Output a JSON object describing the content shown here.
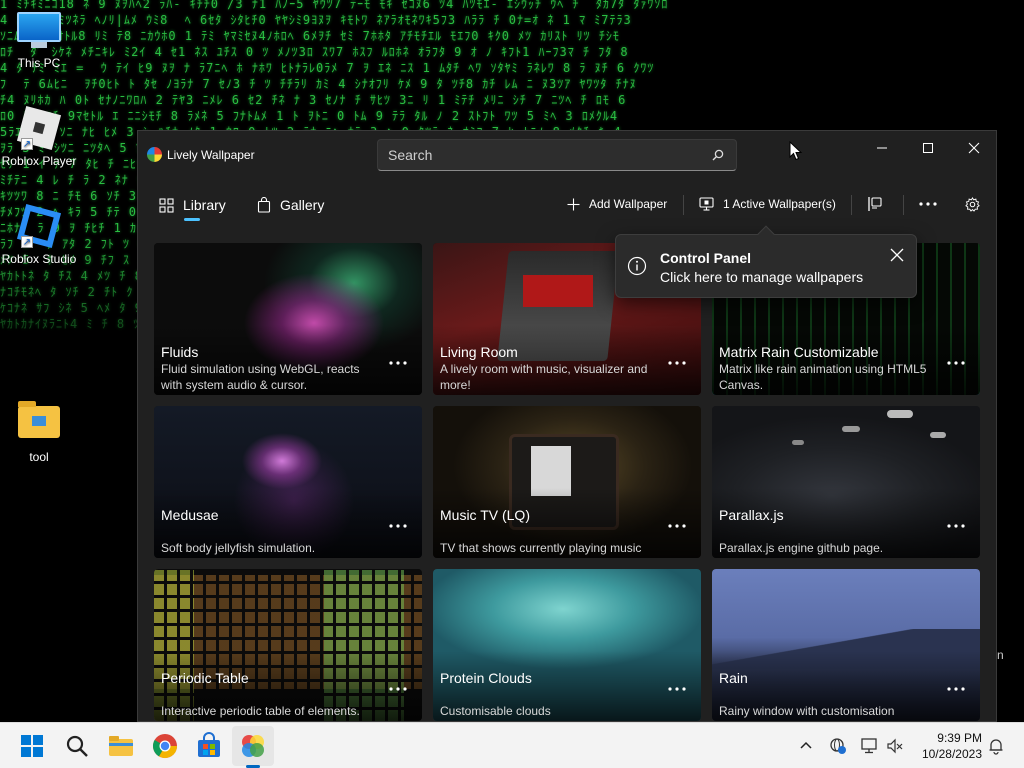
{
  "desktop": {
    "icons": [
      {
        "label": "This PC"
      },
      {
        "label": "Roblox Player"
      },
      {
        "label": "Roblox Studio"
      },
      {
        "label": "tool"
      }
    ],
    "edge_text": "n"
  },
  "window": {
    "title": "Lively Wallpaper",
    "search_placeholder": "Search",
    "nav": {
      "library": "Library",
      "gallery": "Gallery",
      "add_wallpaper": "Add Wallpaper",
      "active_wallpapers": "1 Active Wallpaper(s)"
    },
    "tooltip": {
      "title": "Control Panel",
      "text": "Click here to manage wallpapers"
    },
    "wallpapers": [
      {
        "title": "Fluids",
        "description": "Fluid simulation using WebGL, reacts with system audio & cursor."
      },
      {
        "title": "Living Room",
        "description": "A lively room with music, visualizer and more!"
      },
      {
        "title": "Matrix Rain Customizable",
        "description": "Matrix like rain animation using HTML5 Canvas."
      },
      {
        "title": "Medusae",
        "description": "Soft body jellyfish simulation."
      },
      {
        "title": "Music TV (LQ)",
        "description": "TV that shows currently playing music"
      },
      {
        "title": "Parallax.js",
        "description": "Parallax.js engine github page."
      },
      {
        "title": "Periodic Table",
        "description": "Interactive periodic table of elements."
      },
      {
        "title": "Protein Clouds",
        "description": "Customisable clouds"
      },
      {
        "title": "Rain",
        "description": "Rainy window with customisation"
      }
    ]
  },
  "taskbar": {
    "time": "9:39 PM",
    "date": "10/28/2023"
  },
  "colors": {
    "accent": "#4cc2ff",
    "window_bg": "#202020",
    "matrix_green": "#2fd24a",
    "taskbar_bg": "#f3f3f3"
  }
}
